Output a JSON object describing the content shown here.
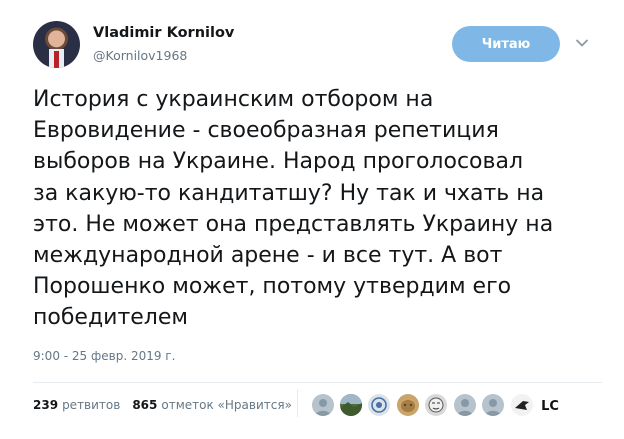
{
  "author": {
    "name": "Vladimir Kornilov",
    "handle": "@Kornilov1968"
  },
  "follow_button": {
    "label": "Читаю"
  },
  "tweet": {
    "lines": [
      "История с украинским отбором на",
      "Евровидение - своеобразная репетиция",
      "выборов на Украине. Народ проголосовал",
      "за какую-то кандитатшу? Ну так и чхать на",
      "это. Не может она представлять Украину на",
      "международной арене - и все тут. А вот",
      "Порошенко может, потому утвердим его",
      "победителем"
    ],
    "timestamp": "9:00 - 25 февр. 2019 г."
  },
  "stats": {
    "retweets_count": "239",
    "retweets_label": "ретвитов",
    "likes_count": "865",
    "likes_label": "отметок «Нравится»"
  },
  "likers": [
    {
      "icon": "default-avatar-icon",
      "color": "#b6c2cc"
    },
    {
      "icon": "landscape-avatar-icon",
      "color": "#4f6b3a"
    },
    {
      "icon": "emblem-avatar-icon",
      "color": "#dbe3ea"
    },
    {
      "icon": "animal-avatar-icon",
      "color": "#c9a46b"
    },
    {
      "icon": "face-sketch-avatar-icon",
      "color": "#d9d9d9"
    },
    {
      "icon": "default-avatar-icon",
      "color": "#b6c2cc"
    },
    {
      "icon": "default-avatar-icon",
      "color": "#b6c2cc"
    },
    {
      "icon": "bird-avatar-icon",
      "color": "#f2f2f2"
    },
    {
      "icon": "lc-logo-avatar-icon",
      "color": "#ffffff"
    }
  ]
}
